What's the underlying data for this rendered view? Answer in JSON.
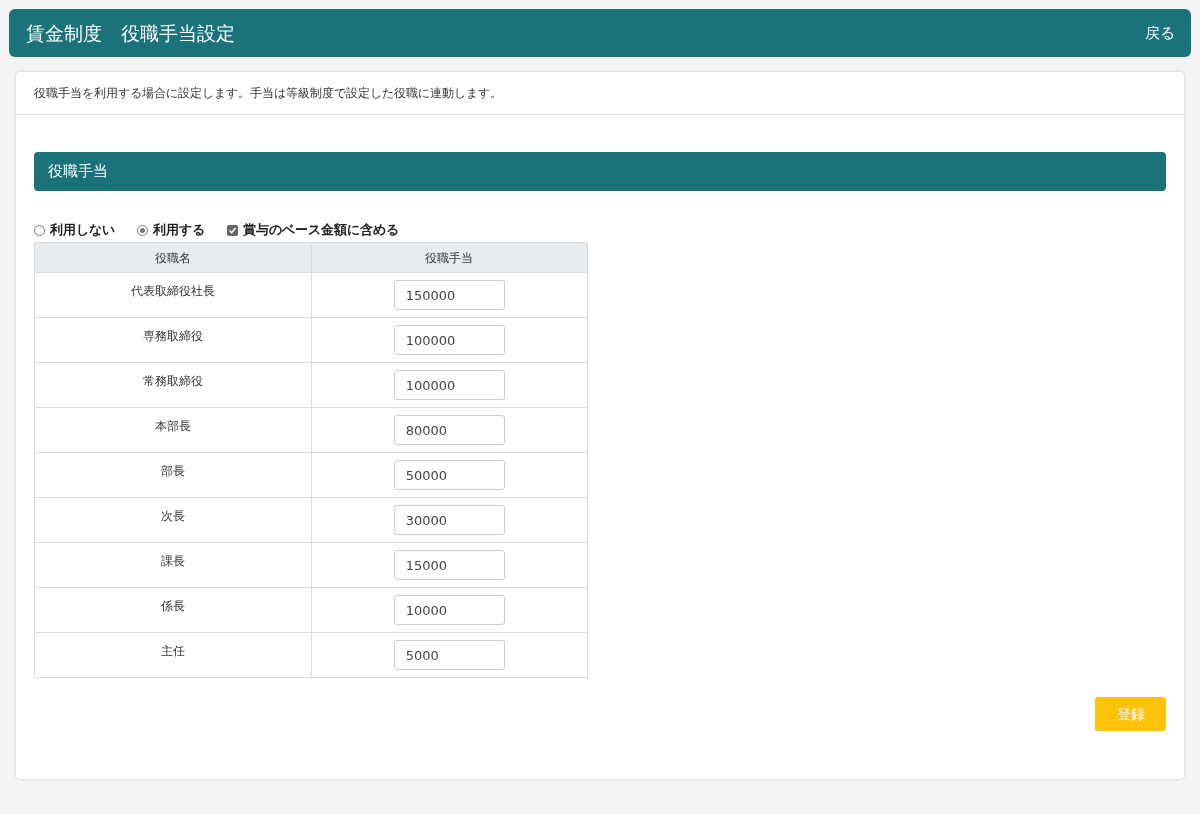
{
  "header": {
    "title": "賃金制度　役職手当設定",
    "back_link": "戻る"
  },
  "description": "役職手当を利用する場合に設定します。手当は等級制度で設定した役職に連動します。",
  "section": {
    "title": "役職手当"
  },
  "options": [
    {
      "kind": "radio",
      "label": "利用しない",
      "selected": false
    },
    {
      "kind": "radio",
      "label": "利用する",
      "selected": true
    },
    {
      "kind": "checkbox",
      "label": "賞与のベース金額に含める",
      "checked": true
    }
  ],
  "table": {
    "columns": [
      "役職名",
      "役職手当"
    ],
    "rows": [
      {
        "name": "代表取締役社長",
        "value": "150000"
      },
      {
        "name": "専務取締役",
        "value": "100000"
      },
      {
        "name": "常務取締役",
        "value": "100000"
      },
      {
        "name": "本部長",
        "value": "80000"
      },
      {
        "name": "部長",
        "value": "50000"
      },
      {
        "name": "次長",
        "value": "30000"
      },
      {
        "name": "課長",
        "value": "15000"
      },
      {
        "name": "係長",
        "value": "10000"
      },
      {
        "name": "主任",
        "value": "5000"
      }
    ]
  },
  "submit_button": "登録"
}
